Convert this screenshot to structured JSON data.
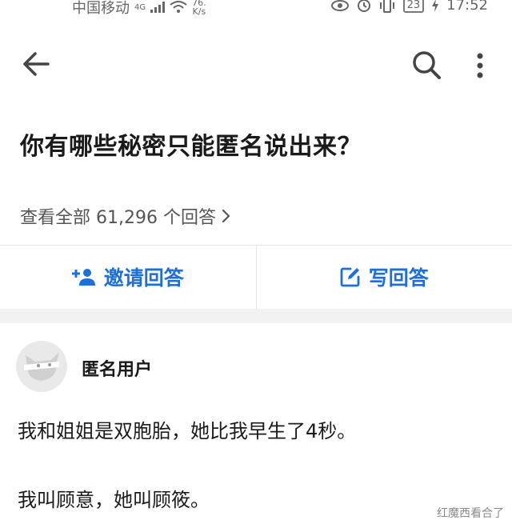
{
  "status_bar": {
    "carrier": "中国移动",
    "network": "4G",
    "speed_value": "76.",
    "speed_unit": "K/s",
    "battery": "23",
    "time": "17:52"
  },
  "top_bar": {
    "back_icon": "arrow-left-icon",
    "search_icon": "search-icon",
    "more_icon": "more-vertical-icon"
  },
  "question": {
    "title": "你有哪些秘密只能匿名说出来？",
    "view_all": "查看全部 61,296 个回答"
  },
  "actions": {
    "invite_label": "邀请回答",
    "write_label": "写回答",
    "accent_color": "#1e6fd9"
  },
  "answer": {
    "author": "匿名用户",
    "lines": [
      "我和姐姐是双胞胎，她比我早生了4秒。",
      "我叫顾意，她叫顾筱。"
    ]
  },
  "watermark": "红魔西看合了"
}
